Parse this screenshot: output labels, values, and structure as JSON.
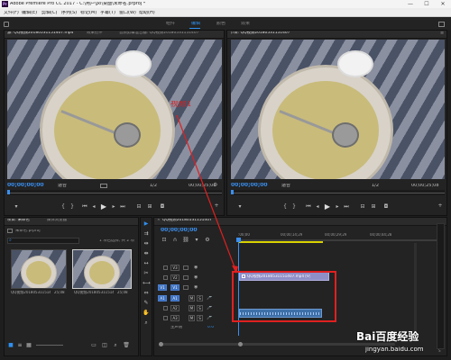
{
  "window": {
    "title": "Adobe Premiere Pro CC 2017 - C:\\用户\\jxl\\桌面\\未命名.prproj *",
    "logo": "Pr",
    "minimize": "—",
    "maximize": "☐",
    "close": "✕"
  },
  "menu": [
    "文件(F)",
    "编辑(E)",
    "剪辑(C)",
    "序列(S)",
    "标记(M)",
    "字幕(T)",
    "窗口(W)",
    "帮助(H)"
  ],
  "workspaces": [
    "组件",
    "编辑",
    "颜色",
    "效果"
  ],
  "source_monitor": {
    "tabs": [
      "源: QQ视频20180531151407.mp4",
      "效果控件",
      "音频剪辑混合器: QQ视频20180531151407"
    ],
    "overlay_text": "视频1",
    "timecode_in": "00;00;00;00",
    "fit": "适合",
    "fraction": "1/2",
    "timecode_out": "00;00;25;08"
  },
  "program_monitor": {
    "tabs": [
      "节目: QQ视频20180531151407"
    ],
    "timecode_in": "00;00;00;00",
    "fit": "适合",
    "fraction": "1/2",
    "timecode_out": "00;00;25;08"
  },
  "project_panel": {
    "tabs": [
      "项目: 未命名",
      "媒体浏览器"
    ],
    "project_file": "未命名.prproj",
    "search_placeholder": "",
    "items_count": "1 项已选择, 共 2 项",
    "clips": [
      {
        "name": "QQ视频20180531151407.mp4",
        "duration": "25;08"
      },
      {
        "name": "QQ视频20180531151407",
        "duration": "25;08"
      }
    ]
  },
  "timeline": {
    "tab": "QQ视频20180531151407",
    "timecode": "00;00;00;00",
    "ruler": [
      ":00;00",
      "00;00;14;29",
      "00;00;29;29",
      "00;00;44;28"
    ],
    "video_tracks": [
      "V3",
      "V2",
      "V1"
    ],
    "audio_tracks": [
      "A1",
      "A2",
      "A3"
    ],
    "source_patch_v": "V1",
    "source_patch_a": "A1",
    "master": "主声道",
    "master_value": "0.0",
    "video_clip": "QQ视频20180531151407.mp4 [V]",
    "audio_clip": ""
  },
  "watermark": {
    "brand": "Bai百度经验",
    "url": "jingyan.baidu.com"
  },
  "icons": {
    "play": "play-icon",
    "step_back": "step-back-icon",
    "step_forward": "step-forward-icon",
    "mark_in": "mark-in-icon",
    "mark_out": "mark-out-icon",
    "add": "plus-icon",
    "wrench": "wrench-icon",
    "selection": "selection-tool-icon",
    "razor": "razor-tool-icon",
    "hand": "hand-tool-icon",
    "pen": "pen-tool-icon",
    "text": "type-tool-icon",
    "lock": "lock-icon",
    "eye": "eye-icon",
    "mic": "mic-icon"
  },
  "colors": {
    "accent": "#2f8ff0",
    "annotation": "#e02020",
    "clip_video": "#8f8fc8",
    "clip_audio": "#3d6fa8",
    "overlay_text": "#d62020"
  }
}
